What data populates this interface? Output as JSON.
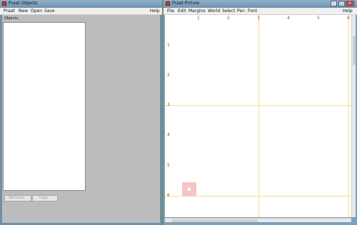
{
  "objects_window": {
    "title": "Praat Objects",
    "menu": [
      "Praat",
      "New",
      "Open",
      "Save"
    ],
    "help": "Help",
    "objects_label": "Objects:",
    "buttons": {
      "rename": "Rename...",
      "copy": "Copy..."
    }
  },
  "picture_window": {
    "title": "Praat Picture",
    "menu": [
      "File",
      "Edit",
      "Margins",
      "World",
      "Select",
      "Pen",
      "Font"
    ],
    "help": "Help",
    "controls": {
      "minimize": "–",
      "maximize": "□",
      "close": "✕"
    },
    "top_axis": [
      "1",
      "2",
      "3",
      "4",
      "5",
      "6"
    ],
    "left_axis": [
      "1",
      "2",
      "3",
      "4",
      "5",
      "6"
    ]
  },
  "colors": {
    "axis_label": "#c0392b",
    "grid_line": "#f4e27a",
    "selection": "#f5c5c5"
  }
}
